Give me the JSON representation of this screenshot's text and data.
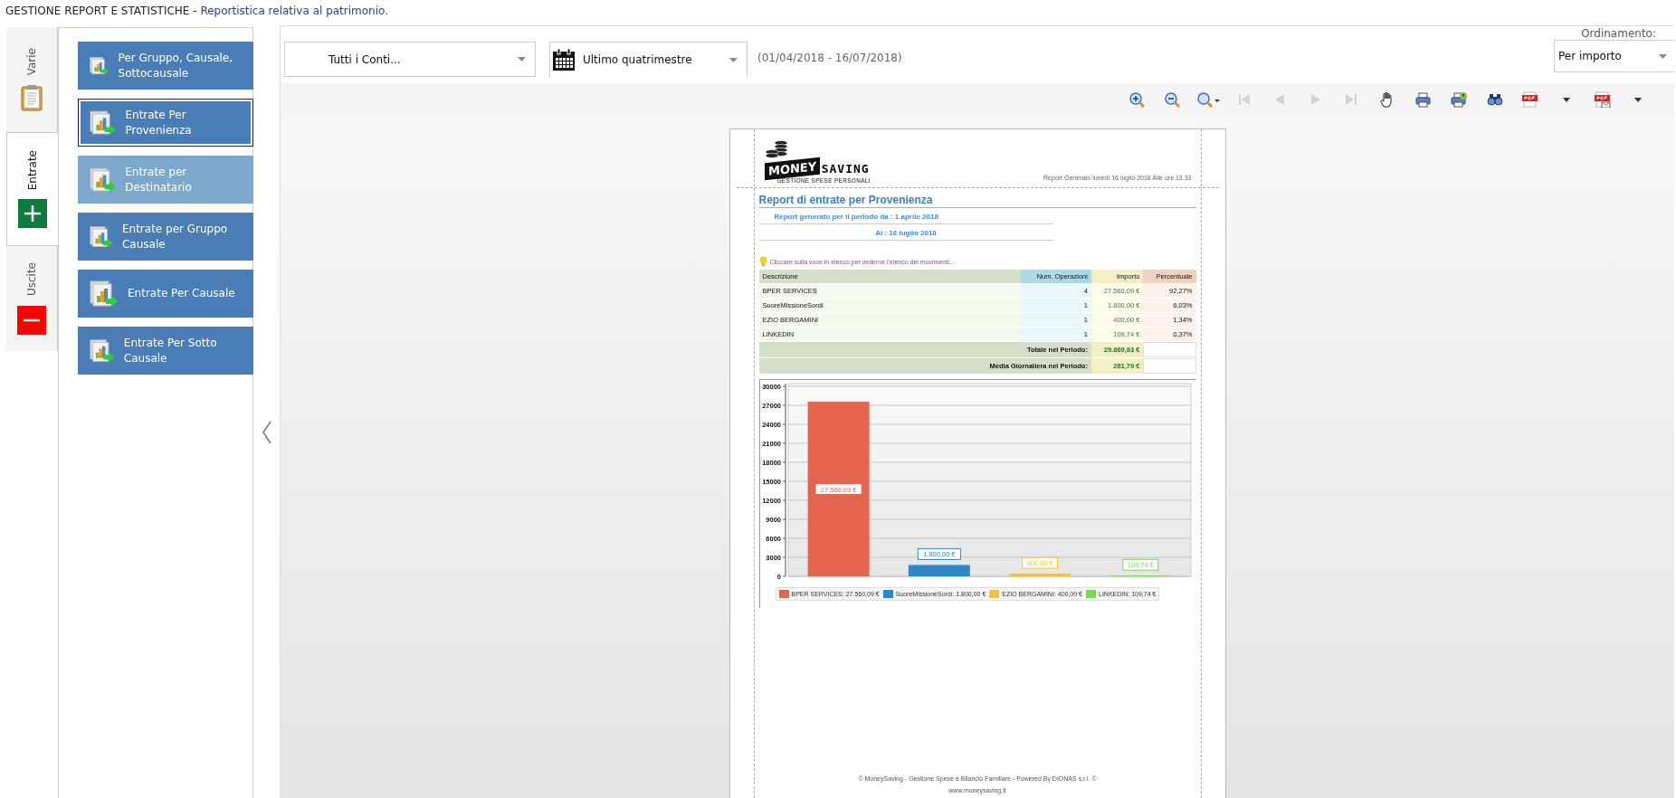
{
  "header": {
    "title": "GESTIONE REPORT E STATISTICHE -",
    "subtitle": "Reportistica relativa al patrimonio."
  },
  "side_tabs": [
    {
      "label": "Varie",
      "kind": "clipboard",
      "selected": false
    },
    {
      "label": "Entrate",
      "kind": "plus",
      "selected": true
    },
    {
      "label": "Uscite",
      "kind": "minus",
      "selected": false
    }
  ],
  "report_menu": [
    {
      "label": "Per Gruppo, Causale, Sottocausale",
      "selected": false,
      "highlighted": false
    },
    {
      "label": "Entrate Per Provenienza",
      "selected": true,
      "highlighted": false
    },
    {
      "label": "Entrate per Destinatario",
      "selected": false,
      "highlighted": true
    },
    {
      "label": "Entrate per Gruppo Causale",
      "selected": false,
      "highlighted": false
    },
    {
      "label": "Entrate Per Causale",
      "selected": false,
      "highlighted": false
    },
    {
      "label": "Entrate Per Sotto Causale",
      "selected": false,
      "highlighted": false
    }
  ],
  "filters": {
    "account": "Tutti i Conti...",
    "period": "Ultimo quatrimestre",
    "date_range": "(01/04/2018 - 16/07/2018)",
    "sort_label": "Ordinamento:",
    "sort": "Per importo"
  },
  "toolbar": [
    {
      "kind": "zoom-in",
      "disabled": false
    },
    {
      "kind": "zoom-out",
      "disabled": false
    },
    {
      "kind": "zoom-menu",
      "disabled": false
    },
    {
      "kind": "first-page",
      "disabled": true
    },
    {
      "kind": "prev-page",
      "disabled": true
    },
    {
      "kind": "next-page",
      "disabled": true
    },
    {
      "kind": "last-page",
      "disabled": true
    },
    {
      "kind": "hand",
      "disabled": false
    },
    {
      "kind": "print",
      "disabled": false
    },
    {
      "kind": "quick-print",
      "disabled": false
    },
    {
      "kind": "find",
      "disabled": false
    },
    {
      "kind": "pdf",
      "disabled": false
    },
    {
      "kind": "caret",
      "disabled": false
    },
    {
      "kind": "pdf-mail",
      "disabled": false
    },
    {
      "kind": "caret",
      "disabled": false
    }
  ],
  "report": {
    "brand_left": "MONEY",
    "brand_right": "SAVING",
    "brand_tagline": "GESTIONE SPESE PERSONALI",
    "generated": "Report Generato lunedì 16 luglio 2018 Alle ore 13.33",
    "title": "Report di entrate per Provenienza",
    "period_from": "Report generato per il periodo da : 1 aprile 2018",
    "period_to": "Al : 16 luglio 2018",
    "hint": "Cliccare sulla voce in elenco per vederne l'elenco dei movimenti...",
    "table": {
      "columns": [
        "Descrizione",
        "Num. Operazioni",
        "Importo",
        "Percentuale"
      ],
      "rows": [
        [
          "BPER SERVICES",
          "4",
          "27.560,09 €",
          "92,27%"
        ],
        [
          "SuoreMissioneSordi",
          "1",
          "1.800,00 €",
          "6,03%"
        ],
        [
          "EZIO BERGAMINI",
          "1",
          "400,00 €",
          "1,34%"
        ],
        [
          "LINKEDIN",
          "1",
          "109,74 €",
          "0,37%"
        ]
      ],
      "totals": [
        {
          "label": "Totale nel Periodo:",
          "value": "29.869,83 €"
        },
        {
          "label": "Media Giornaliera nel Periodo:",
          "value": "281,79 €"
        }
      ]
    },
    "chart_data": {
      "type": "bar",
      "grid": true,
      "series": [
        {
          "values": [
            27560.09,
            1800,
            400,
            109.74
          ]
        }
      ],
      "ylim": [
        0,
        30000
      ],
      "yticks": [
        0,
        3000,
        6000,
        9000,
        12000,
        15000,
        18000,
        21000,
        24000,
        27000,
        30000
      ],
      "value_labels": [
        "27.560,09 €",
        "1.800,00 €",
        "400,00 €",
        "109,74 €"
      ]
    },
    "legend": [
      {
        "label": "BPER SERVICES: 27.560,09 €",
        "color": "#e5644f"
      },
      {
        "label": "SuoreMissioneSordi: 1.800,00 €",
        "color": "#2e88c6"
      },
      {
        "label": "EZIO BERGAMINI: 400,00 €",
        "color": "#f0c040"
      },
      {
        "label": "LINKEDIN: 109,74 €",
        "color": "#7ed35c"
      }
    ],
    "footer": "© MoneySaving - Gestione Spese e Bilancio Familiare - Powered By DIONAS s.r.l. ©",
    "website": "www.moneysaving.it"
  }
}
